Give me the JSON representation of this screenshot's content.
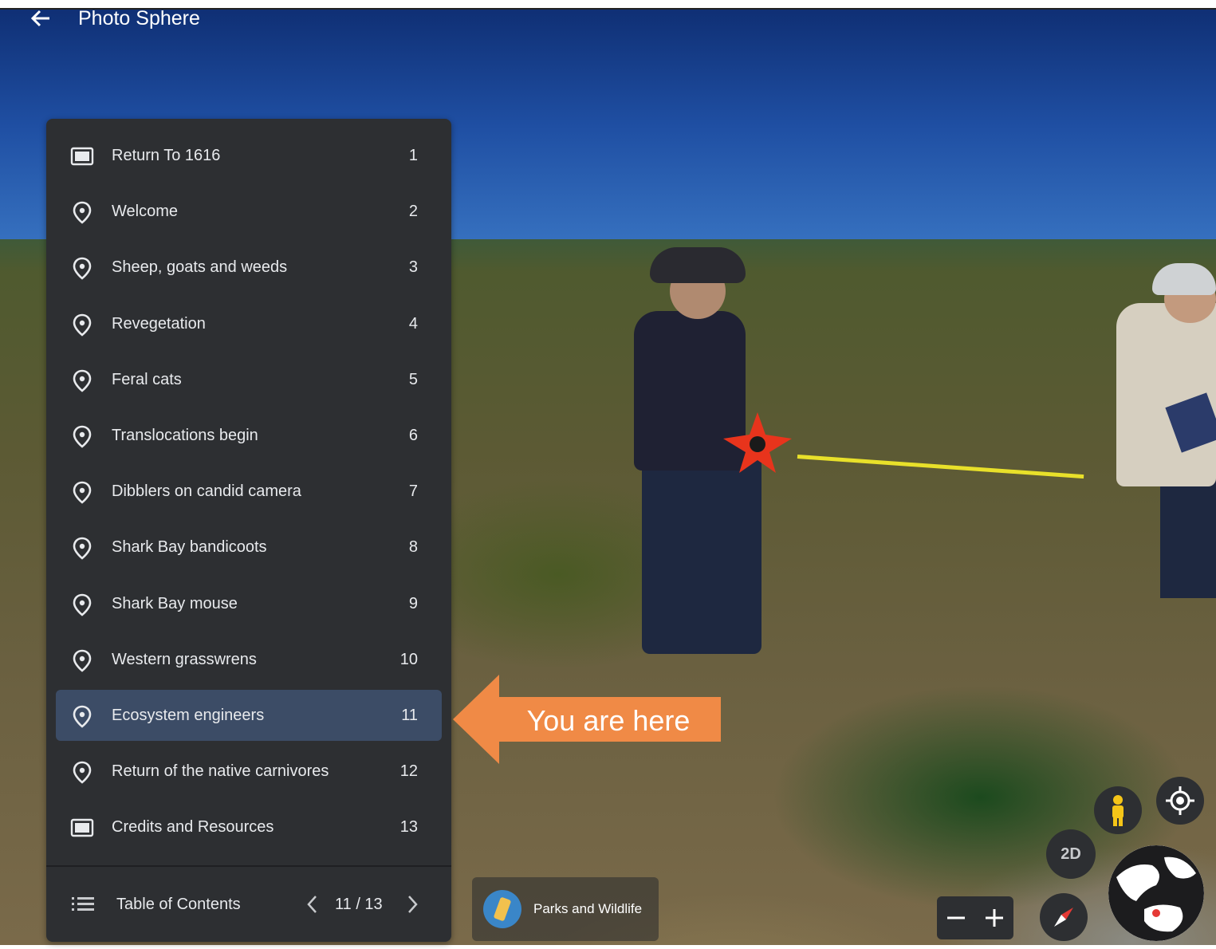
{
  "header": {
    "title": "Photo Sphere",
    "back_icon": "arrow-left-icon"
  },
  "toc": {
    "items": [
      {
        "label": "Return To 1616",
        "number": "1",
        "icon": "slide-icon"
      },
      {
        "label": "Welcome",
        "number": "2",
        "icon": "location-pin-icon"
      },
      {
        "label": "Sheep, goats and weeds",
        "number": "3",
        "icon": "location-pin-icon"
      },
      {
        "label": "Revegetation",
        "number": "4",
        "icon": "location-pin-icon"
      },
      {
        "label": "Feral cats",
        "number": "5",
        "icon": "location-pin-icon"
      },
      {
        "label": "Translocations begin",
        "number": "6",
        "icon": "location-pin-icon"
      },
      {
        "label": "Dibblers on candid camera",
        "number": "7",
        "icon": "location-pin-icon"
      },
      {
        "label": "Shark Bay bandicoots",
        "number": "8",
        "icon": "location-pin-icon"
      },
      {
        "label": "Shark Bay mouse",
        "number": "9",
        "icon": "location-pin-icon"
      },
      {
        "label": "Western grasswrens",
        "number": "10",
        "icon": "location-pin-icon"
      },
      {
        "label": "Ecosystem engineers",
        "number": "11",
        "icon": "location-pin-icon",
        "active": true
      },
      {
        "label": "Return of the native carnivores",
        "number": "12",
        "icon": "location-pin-icon"
      },
      {
        "label": "Credits and Resources",
        "number": "13",
        "icon": "slide-icon"
      }
    ],
    "footer": {
      "label": "Table of Contents",
      "page_indicator": "11 / 13"
    }
  },
  "callout": {
    "text": "You are here",
    "color": "#f08a46"
  },
  "attribution": {
    "text": "Parks and Wildlife"
  },
  "map_controls": {
    "two_d_label": "2D",
    "pegman_color": "#f5c518",
    "compass_color": "#e53935"
  },
  "colors": {
    "panel": "#2d2f32",
    "active_item": "#3c4c66",
    "text": "#e8eaed"
  }
}
